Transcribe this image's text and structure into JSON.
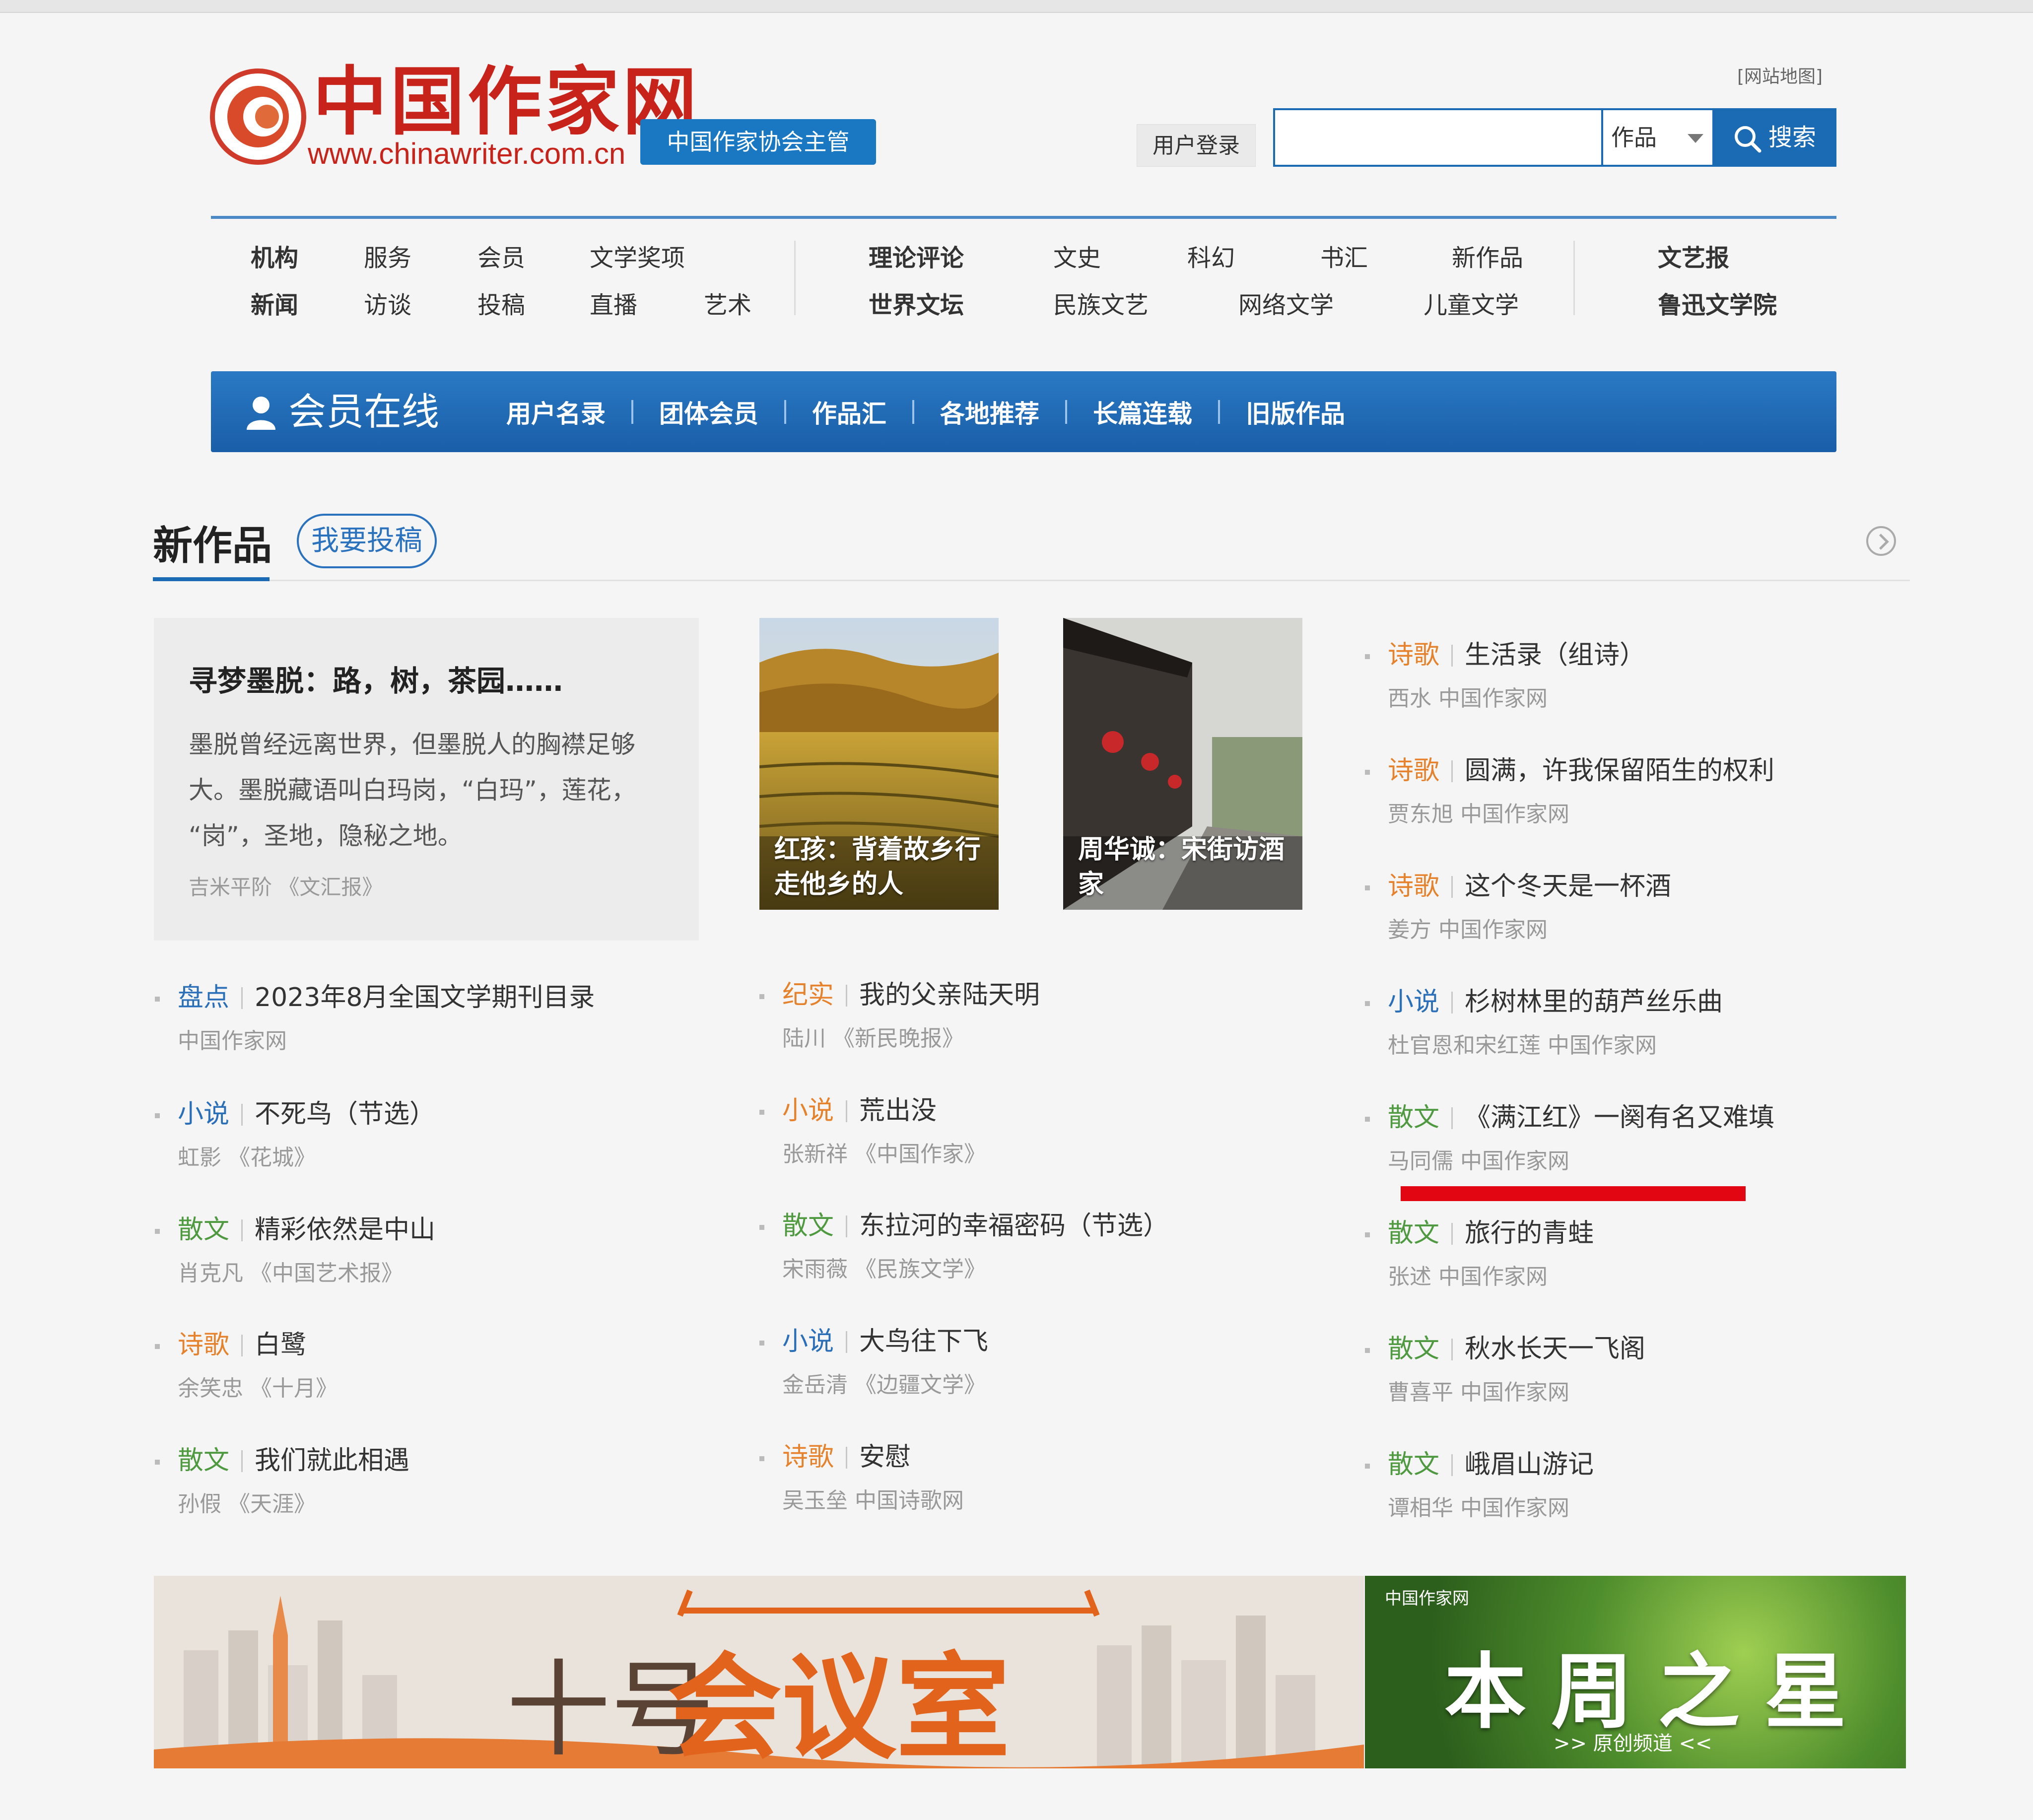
{
  "header": {
    "logo_text": "中国作家网",
    "logo_url": "www.chinawriter.com.cn",
    "host_badge": "中国作家协会主管",
    "sitemap": "[网站地图]",
    "login": "用户登录",
    "search_select": "作品",
    "search_button": "搜索"
  },
  "nav": {
    "group1_row1": [
      "机构",
      "服务",
      "会员",
      "文学奖项"
    ],
    "group1_row2": [
      "新闻",
      "访谈",
      "投稿",
      "直播",
      "艺术"
    ],
    "group2_row1": [
      "理论评论",
      "文史",
      "科幻",
      "书汇",
      "新作品"
    ],
    "group2_row2": [
      "世界文坛",
      "民族文艺",
      "网络文学",
      "儿童文学"
    ],
    "group3": [
      "文艺报",
      "鲁迅文学院"
    ]
  },
  "member": {
    "title": "会员在线",
    "links": [
      "用户名录",
      "团体会员",
      "作品汇",
      "各地推荐",
      "长篇连载",
      "旧版作品"
    ]
  },
  "section": {
    "title": "新作品",
    "submit": "我要投稿"
  },
  "feature": {
    "title": "寻梦墨脱：路，树，茶园……",
    "lines": [
      "墨脱曾经远离世界，但墨脱人的胸襟足够",
      "大。墨脱藏语叫白玛岗，“白玛”，莲花，",
      "“岗”，圣地，隐秘之地。"
    ],
    "source": "吉米平阶 《文汇报》"
  },
  "photos": [
    {
      "caption1": "红孩：背着故乡行",
      "caption2": "走他乡的人"
    },
    {
      "caption1": "周华诚：宋街访酒",
      "caption2": "家"
    }
  ],
  "list_left": [
    {
      "cat": "盘点",
      "title": "2023年8月全国文学期刊目录",
      "meta": "中国作家网"
    },
    {
      "cat": "小说",
      "title": "不死鸟（节选）",
      "meta": "虹影 《花城》"
    },
    {
      "cat": "散文",
      "title": "精彩依然是中山",
      "meta": "肖克凡 《中国艺术报》"
    },
    {
      "cat": "诗歌",
      "title": "白鹭",
      "meta": "余笑忠 《十月》"
    },
    {
      "cat": "散文",
      "title": "我们就此相遇",
      "meta": "孙假 《天涯》"
    }
  ],
  "list_middle": [
    {
      "cat": "纪实",
      "title": "我的父亲陆天明",
      "meta": "陆川 《新民晚报》"
    },
    {
      "cat": "小说",
      "title": "荒出没",
      "meta": "张新祥 《中国作家》"
    },
    {
      "cat": "散文",
      "title": "东拉河的幸福密码（节选）",
      "meta": "宋雨薇 《民族文学》"
    },
    {
      "cat": "小说",
      "title": "大鸟往下飞",
      "meta": "金岳清 《边疆文学》"
    },
    {
      "cat": "诗歌",
      "title": "安慰",
      "meta": "吴玉垒 中国诗歌网"
    }
  ],
  "list_right": [
    {
      "cat": "诗歌",
      "title": "生活录（组诗）",
      "meta": "西水 中国作家网"
    },
    {
      "cat": "诗歌",
      "title": "圆满，许我保留陌生的权利",
      "meta": "贾东旭 中国作家网"
    },
    {
      "cat": "诗歌",
      "title": "这个冬天是一杯酒",
      "meta": "姜方 中国作家网"
    },
    {
      "cat": "小说",
      "title": "杉树林里的葫芦丝乐曲",
      "meta": "杜官恩和宋红莲 中国作家网"
    },
    {
      "cat": "散文",
      "title": "《满江红》一阕有名又难填",
      "meta": "马同儒 中国作家网"
    },
    {
      "cat": "散文",
      "title": "旅行的青蛙",
      "meta": "张述 中国作家网"
    },
    {
      "cat": "散文",
      "title": "秋水长天一飞阁",
      "meta": "曹喜平 中国作家网"
    },
    {
      "cat": "散文",
      "title": "峨眉山游记",
      "meta": "谭相华 中国作家网"
    }
  ],
  "banners": {
    "left_part1": "十号",
    "left_part2": "会议室",
    "right_title": "本周之星",
    "right_sub": ">> 原创频道 <<",
    "right_logo": "中国作家网"
  },
  "colors": {
    "accent": "#1b6ab4",
    "logo_red": "#c8231b",
    "highlight_red": "#e20612"
  }
}
